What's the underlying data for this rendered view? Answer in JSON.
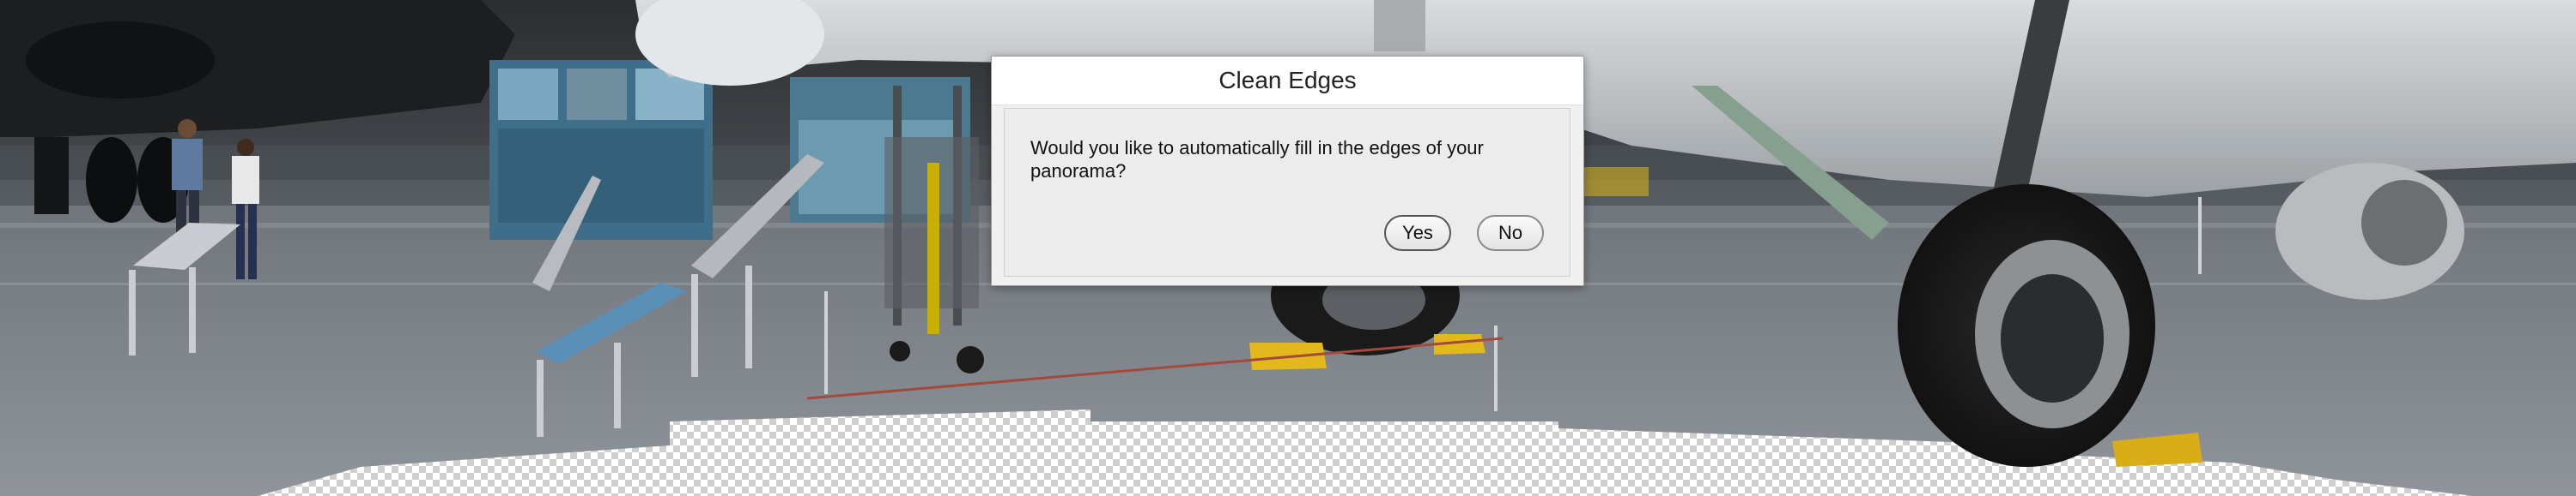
{
  "dialog": {
    "title": "Clean Edges",
    "message": "Would you like to automatically fill in the edges of your panorama?",
    "buttons": {
      "yes_label": "Yes",
      "no_label": "No"
    }
  },
  "background": {
    "description_icon": "panorama-photo",
    "transparent_fill": "checkerboard"
  },
  "colors": {
    "dialog_bg": "#f0f0f0",
    "dialog_title_bg": "#ffffff",
    "button_border": "#8a8a8a"
  }
}
